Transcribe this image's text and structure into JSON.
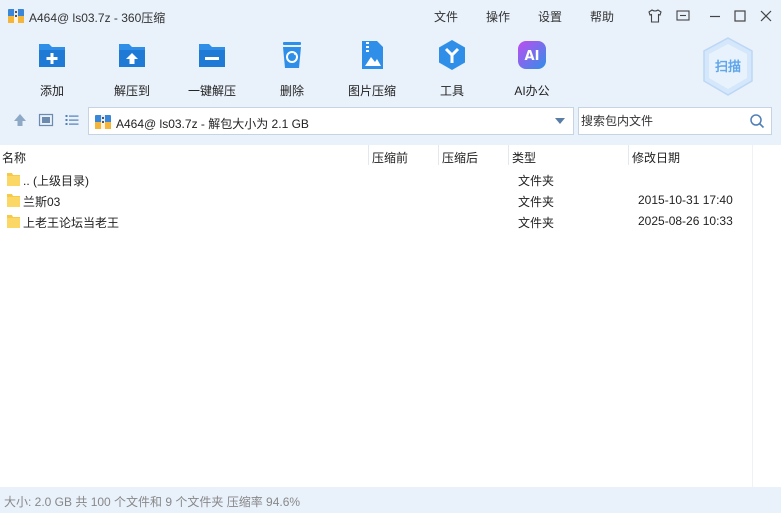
{
  "window": {
    "title": "A464@ ls03.7z - 360压缩",
    "menu": [
      "文件",
      "操作",
      "设置",
      "帮助"
    ]
  },
  "toolbar": {
    "items": [
      {
        "label": "添加",
        "icon": "add-file-icon"
      },
      {
        "label": "解压到",
        "icon": "extract-to-icon"
      },
      {
        "label": "一键解压",
        "icon": "one-click-extract-icon"
      },
      {
        "label": "删除",
        "icon": "recycle-bin-icon"
      },
      {
        "label": "图片压缩",
        "icon": "image-compress-icon"
      },
      {
        "label": "工具",
        "icon": "tools-icon"
      },
      {
        "label": "AI办公",
        "icon": "ai-office-icon"
      }
    ],
    "scan_label": "扫描",
    "ai_icon_text": "AI"
  },
  "address": {
    "path": "A464@ ls03.7z - 解包大小为 2.1 GB",
    "search_placeholder": "搜索包内文件"
  },
  "columns": {
    "name": "名称",
    "before": "压缩前",
    "after": "压缩后",
    "type": "类型",
    "modified": "修改日期"
  },
  "files": [
    {
      "name": ".. (上级目录)",
      "type": "文件夹",
      "modified": ""
    },
    {
      "name": "兰斯03",
      "type": "文件夹",
      "modified": "2015-10-31 17:40"
    },
    {
      "name": "上老王论坛当老王",
      "type": "文件夹",
      "modified": "2025-08-26 10:33"
    }
  ],
  "status": {
    "text": "大小: 2.0 GB 共 100 个文件和 9 个文件夹 压缩率 94.6%"
  },
  "colors": {
    "accent": "#2f8fe8",
    "folder": "#f7c948",
    "background": "#e9f1fb"
  }
}
